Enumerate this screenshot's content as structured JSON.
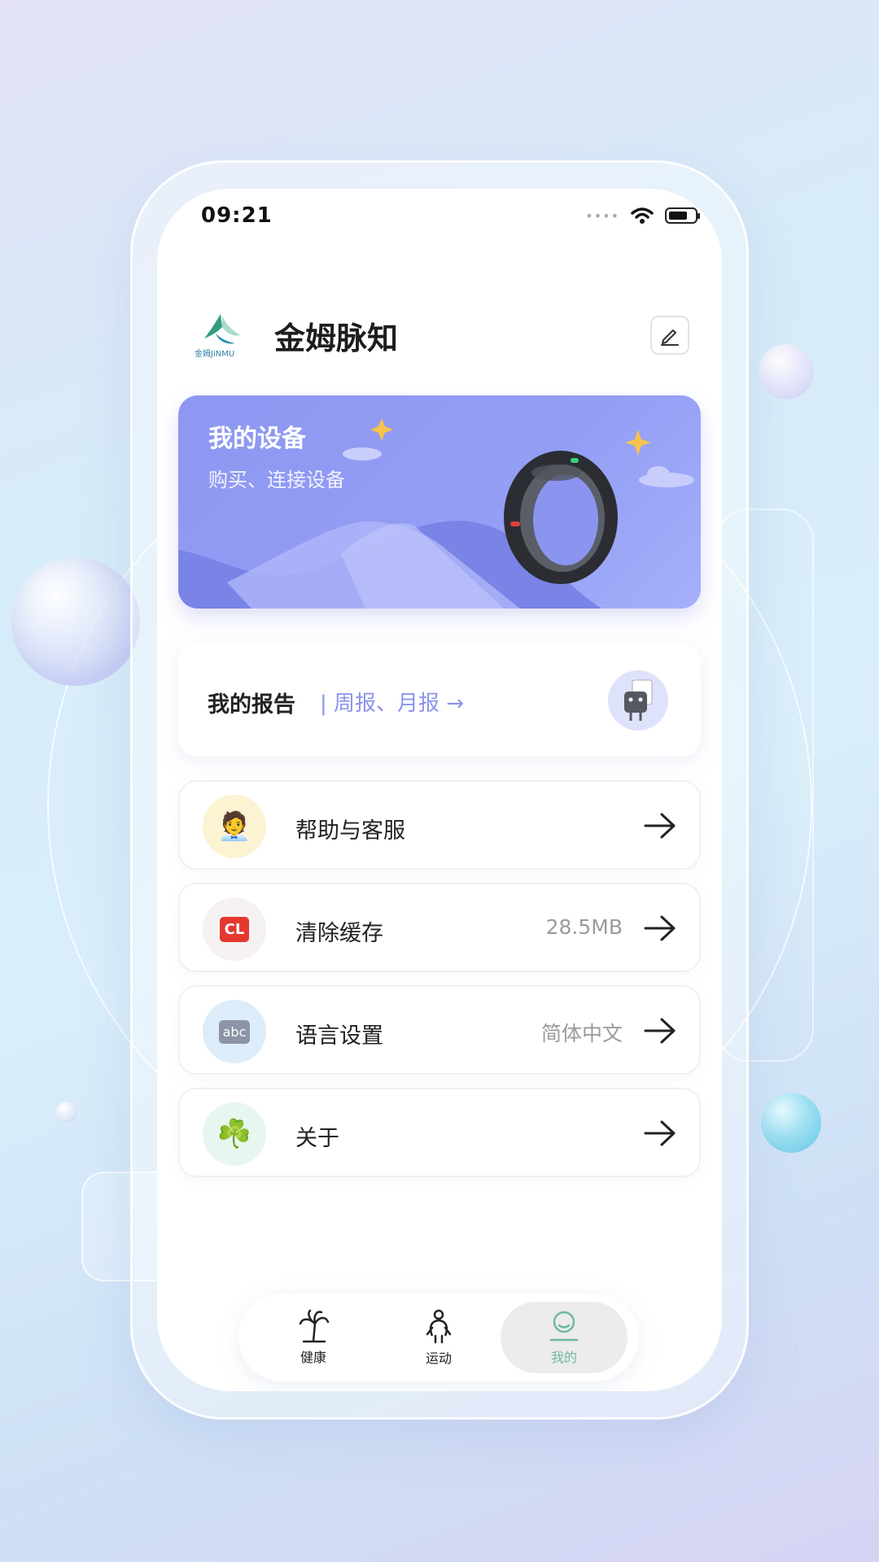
{
  "status_bar": {
    "time": "09:21"
  },
  "header": {
    "logo_text": "金姆JiNMU",
    "title": "金姆脉知",
    "edit_icon": "pencil-icon"
  },
  "device_card": {
    "title": "我的设备",
    "subtitle": "购买、连接设备"
  },
  "report_card": {
    "title": "我的报告",
    "link": "| 周报、月报 →"
  },
  "menu": [
    {
      "label": "帮助与客服",
      "value": "",
      "icon": "🧑‍💼",
      "icon_bg": "#fcf3d3"
    },
    {
      "label": "清除缓存",
      "value": "28.5MB",
      "icon": "CL",
      "icon_bg": "#f5f2f1"
    },
    {
      "label": "语言设置",
      "value": "简体中文",
      "icon": "abc",
      "icon_bg": "#dcedf9"
    },
    {
      "label": "关于",
      "value": "",
      "icon": "☘️",
      "icon_bg": "#e7f6ee"
    }
  ],
  "tabs": [
    {
      "label": "健康",
      "icon": "palm-tree-icon",
      "active": false
    },
    {
      "label": "运动",
      "icon": "person-icon",
      "active": false
    },
    {
      "label": "我的",
      "icon": "user-icon",
      "active": true
    }
  ],
  "colors": {
    "accent": "#8d97f1",
    "tab_active": "#6fb7a4"
  }
}
